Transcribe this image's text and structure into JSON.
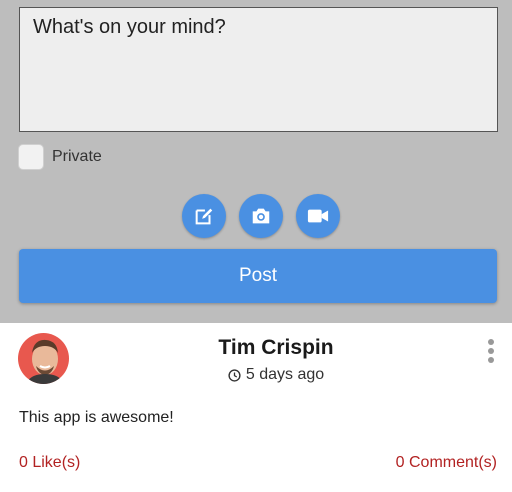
{
  "composer": {
    "placeholder": "What's on your mind?",
    "private_label": "Private",
    "private_checked": false,
    "media_buttons": [
      {
        "icon": "edit-icon"
      },
      {
        "icon": "camera-icon"
      },
      {
        "icon": "video-icon"
      }
    ],
    "post_label": "Post"
  },
  "post": {
    "author": "Tim Crispin",
    "time_ago": "5 days ago",
    "body": "This app is awesome!",
    "likes_label": "0 Like(s)",
    "comments_label": "0 Comment(s)"
  },
  "colors": {
    "accent": "#4a90e2",
    "composer_bg": "#bdbdbd",
    "link_red": "#b22222"
  }
}
